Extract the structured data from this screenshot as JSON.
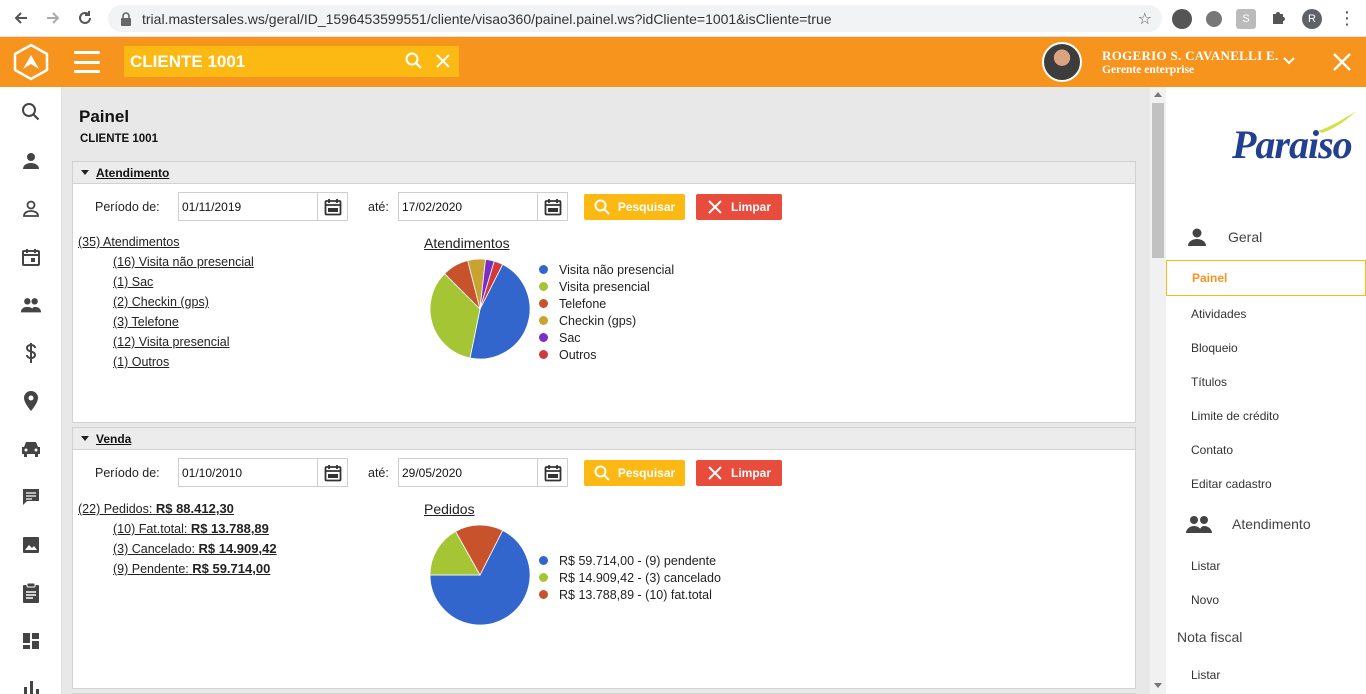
{
  "browser": {
    "url": "trial.mastersales.ws/geral/ID_1596453599551/cliente/visao360/painel.painel.ws?idCliente=1001&isCliente=true",
    "profile_initial": "R"
  },
  "header": {
    "search_value": "CLIENTE 1001",
    "user_name": "ROGERIO S. CAVANELLI E.",
    "user_role": "Gerente enterprise"
  },
  "page": {
    "title": "Painel",
    "subtitle": "CLIENTE 1001"
  },
  "atendimento": {
    "section_title": "Atendimento",
    "period_label": "Período de:",
    "date_from": "01/11/2019",
    "until_label": "até:",
    "date_to": "17/02/2020",
    "search_label": "Pesquisar",
    "clear_label": "Limpar",
    "total_link": "(35) Atendimentos",
    "items": [
      "(16) Visita não presencial",
      "(1) Sac",
      "(2) Checkin (gps)",
      "(3) Telefone",
      "(12) Visita presencial",
      "(1) Outros"
    ]
  },
  "venda": {
    "section_title": "Venda",
    "period_label": "Período de:",
    "date_from": "01/10/2010",
    "until_label": "até:",
    "date_to": "29/05/2020",
    "search_label": "Pesquisar",
    "clear_label": "Limpar",
    "total_prefix": "(22) Pedidos:",
    "total_value": "R$ 88.412,30",
    "items": [
      {
        "prefix": "(10) Fat.total:",
        "value": "R$ 13.788,89"
      },
      {
        "prefix": "(3) Cancelado:",
        "value": "R$ 14.909,42"
      },
      {
        "prefix": "(9) Pendente:",
        "value": "R$ 59.714,00"
      }
    ]
  },
  "chart_data": [
    {
      "type": "pie",
      "title": "Atendimentos",
      "categories": [
        "Visita não presencial",
        "Visita presencial",
        "Telefone",
        "Checkin (gps)",
        "Sac",
        "Outros"
      ],
      "values": [
        16,
        12,
        3,
        2,
        1,
        1
      ],
      "colors": [
        "#3366cc",
        "#a5c535",
        "#c8522c",
        "#c9a331",
        "#7a2ec8",
        "#d03a3a"
      ],
      "legend": "right"
    },
    {
      "type": "pie",
      "title": "Pedidos",
      "categories": [
        "R$ 59.714,00 - (9) pendente",
        "R$ 14.909,42 - (3) cancelado",
        "R$ 13.788,89 - (10) fat.total"
      ],
      "values": [
        59714.0,
        14909.42,
        13788.89
      ],
      "colors": [
        "#3366cc",
        "#a5c535",
        "#c8522c"
      ],
      "legend": "right"
    }
  ],
  "right_menu": {
    "brand": "Paraiso",
    "geral_label": "Geral",
    "geral_items": [
      "Painel",
      "Atividades",
      "Bloqueio",
      "Títulos",
      "Limite de crédito",
      "Contato",
      "Editar cadastro"
    ],
    "atendimento_label": "Atendimento",
    "atendimento_items": [
      "Listar",
      "Novo"
    ],
    "nota_fiscal_label": "Nota fiscal",
    "nota_fiscal_items": [
      "Listar"
    ]
  },
  "colors": {
    "header": "#f7941d",
    "accent": "#fcb913",
    "danger": "#e74c3c"
  }
}
